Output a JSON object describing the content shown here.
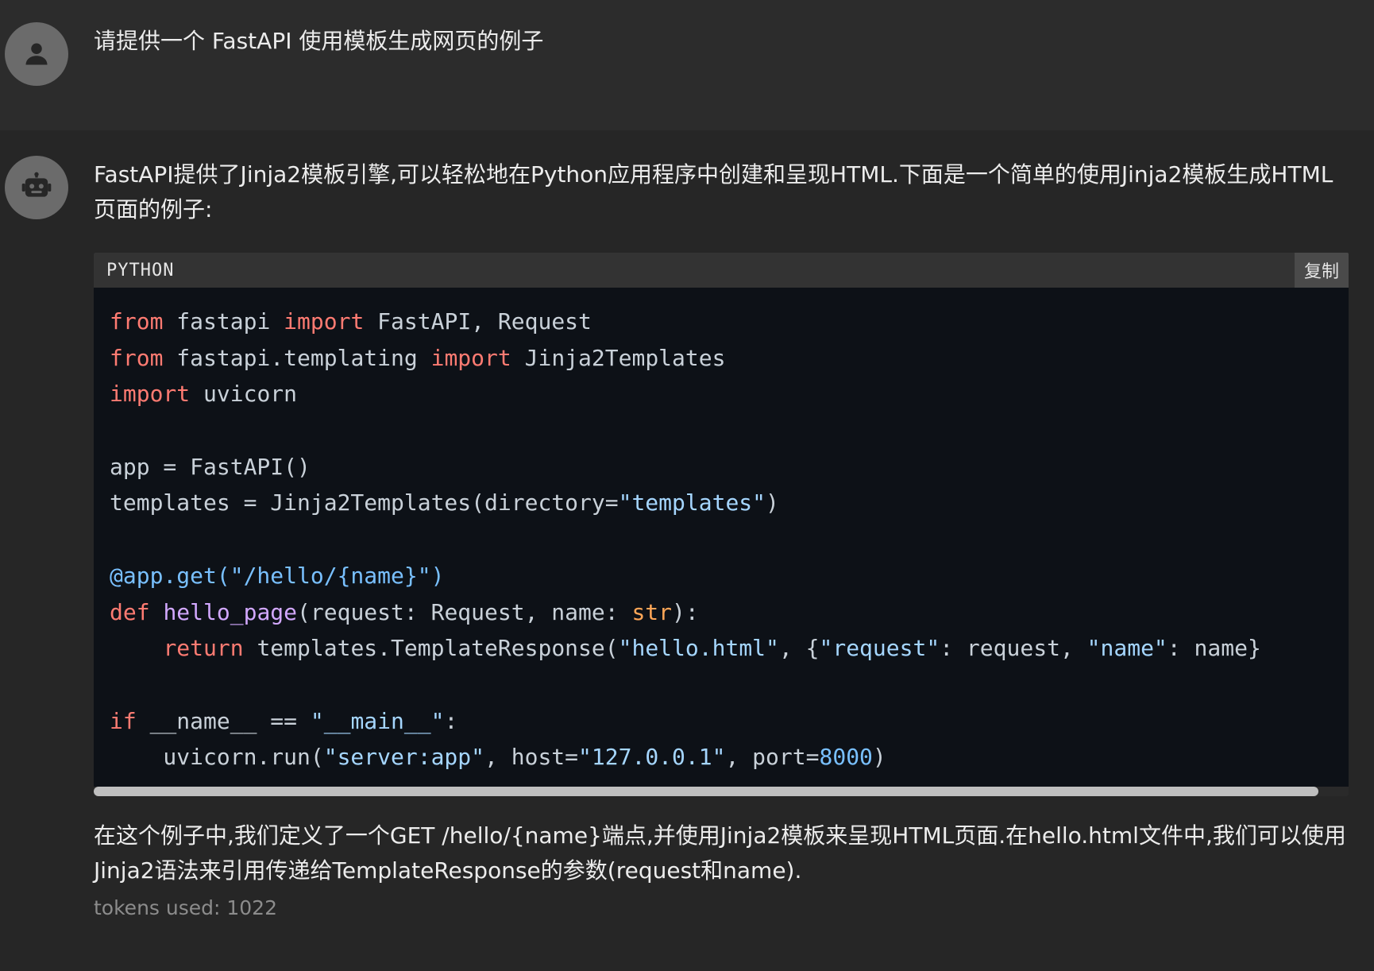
{
  "user_message": {
    "avatar_icon": "person-icon",
    "text": "请提供一个 FastAPI 使用模板生成网页的例子"
  },
  "assistant_message": {
    "avatar_icon": "robot-icon",
    "intro": "FastAPI提供了Jinja2模板引擎,可以轻松地在Python应用程序中创建和呈现HTML.下面是一个简单的使用Jinja2模板生成HTML页面的例子:",
    "code_block": {
      "language": "PYTHON",
      "copy_label": "复制",
      "scroll_position": 0.976,
      "lines": [
        [
          [
            "kw",
            "from"
          ],
          [
            "t",
            " fastapi "
          ],
          [
            "kw",
            "import"
          ],
          [
            "t",
            " FastAPI, Request"
          ]
        ],
        [
          [
            "kw",
            "from"
          ],
          [
            "t",
            " fastapi.templating "
          ],
          [
            "kw",
            "import"
          ],
          [
            "t",
            " Jinja2Templates"
          ]
        ],
        [
          [
            "kw",
            "import"
          ],
          [
            "t",
            " uvicorn"
          ]
        ],
        [],
        [
          [
            "t",
            "app = FastAPI()"
          ]
        ],
        [
          [
            "t",
            "templates = Jinja2Templates(directory="
          ],
          [
            "str",
            "\"templates\""
          ],
          [
            "t",
            ")"
          ]
        ],
        [],
        [
          [
            "dec",
            "@app.get(\"/hello/{name}\")"
          ]
        ],
        [
          [
            "kw",
            "def"
          ],
          [
            "t",
            " "
          ],
          [
            "fn",
            "hello_page"
          ],
          [
            "t",
            "(request: Request, name: "
          ],
          [
            "bi",
            "str"
          ],
          [
            "t",
            "):"
          ]
        ],
        [
          [
            "t",
            "    "
          ],
          [
            "kw",
            "return"
          ],
          [
            "t",
            " templates.TemplateResponse("
          ],
          [
            "str",
            "\"hello.html\""
          ],
          [
            "t",
            ", {"
          ],
          [
            "str",
            "\"request\""
          ],
          [
            "t",
            ": request, "
          ],
          [
            "str",
            "\"name\""
          ],
          [
            "t",
            ": name}"
          ]
        ],
        [],
        [
          [
            "kw",
            "if"
          ],
          [
            "t",
            " __name__ == "
          ],
          [
            "str",
            "\"__main__\""
          ],
          [
            "t",
            ":"
          ]
        ],
        [
          [
            "t",
            "    uvicorn.run("
          ],
          [
            "str",
            "\"server:app\""
          ],
          [
            "t",
            ", host="
          ],
          [
            "str",
            "\"127.0.0.1\""
          ],
          [
            "t",
            ", port="
          ],
          [
            "num",
            "8000"
          ],
          [
            "t",
            ")"
          ]
        ]
      ]
    },
    "explanation": "在这个例子中,我们定义了一个GET /hello/{name}端点,并使用Jinja2模板来呈现HTML页面.在hello.html文件中,我们可以使用Jinja2语法来引用传递给TemplateResponse的参数(request和name).",
    "tokens": "tokens used: 1022"
  },
  "colors": {
    "background": "#262626",
    "user_background": "#2c2c2c",
    "code_background": "#0d1117",
    "keyword": "#ff7b72",
    "string": "#a5d6ff",
    "function": "#d2a8ff",
    "builtin": "#ffa657"
  }
}
